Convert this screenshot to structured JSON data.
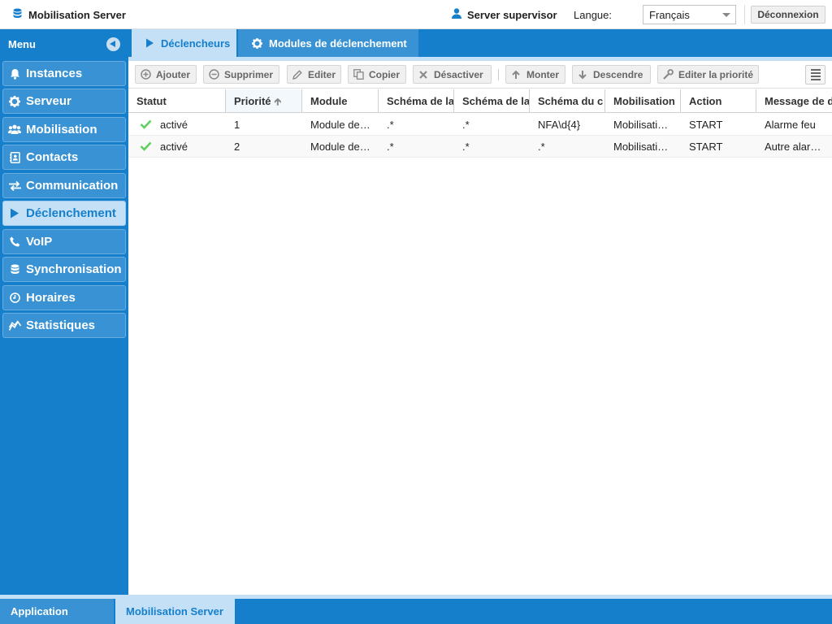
{
  "header": {
    "app_title": "Mobilisation Server",
    "user": "Server supervisor",
    "language_label": "Langue:",
    "language_value": "Français",
    "logout_label": "Déconnexion"
  },
  "sidebar": {
    "title": "Menu",
    "items": [
      {
        "label": "Instances",
        "icon": "bell-icon"
      },
      {
        "label": "Serveur",
        "icon": "gear-icon"
      },
      {
        "label": "Mobilisation",
        "icon": "users-icon"
      },
      {
        "label": "Contacts",
        "icon": "address-book-icon"
      },
      {
        "label": "Communication",
        "icon": "exchange-icon"
      },
      {
        "label": "Déclenchement",
        "icon": "play-icon",
        "active": true
      },
      {
        "label": "VoIP",
        "icon": "phone-icon"
      },
      {
        "label": "Synchronisation",
        "icon": "database-icon"
      },
      {
        "label": "Horaires",
        "icon": "clock-icon"
      },
      {
        "label": "Statistiques",
        "icon": "line-chart-icon"
      }
    ]
  },
  "tabs": [
    {
      "label": "Déclencheurs",
      "icon": "play-icon",
      "active": true
    },
    {
      "label": "Modules de déclenchement",
      "icon": "gear-icon",
      "active": false
    }
  ],
  "toolbar": {
    "add": "Ajouter",
    "delete": "Supprimer",
    "edit": "Editer",
    "copy": "Copier",
    "disable": "Désactiver",
    "up": "Monter",
    "down": "Descendre",
    "edit_priority": "Editer la priorité"
  },
  "grid": {
    "columns": [
      "Statut",
      "Priorité",
      "Module",
      "Schéma de la",
      "Schéma de la",
      "Schéma du c",
      "Mobilisation",
      "Action",
      "Message de d"
    ],
    "sorted_column": "Priorité",
    "rows": [
      [
        "activé",
        "1",
        "Module de…",
        ".*",
        ".*",
        "NFA\\d{4}",
        "Mobilisati…",
        "START",
        "Alarme feu"
      ],
      [
        "activé",
        "2",
        "Module de…",
        ".*",
        ".*",
        ".*",
        "Mobilisati…",
        "START",
        "Autre alar…"
      ]
    ],
    "status_color": "#5fcf5f"
  },
  "footer": {
    "tabs": [
      "Application Server",
      "Mobilisation Server"
    ],
    "active": "Mobilisation Server"
  },
  "colors": {
    "accent": "#157fcc",
    "accent_light": "#c3e0f6"
  }
}
